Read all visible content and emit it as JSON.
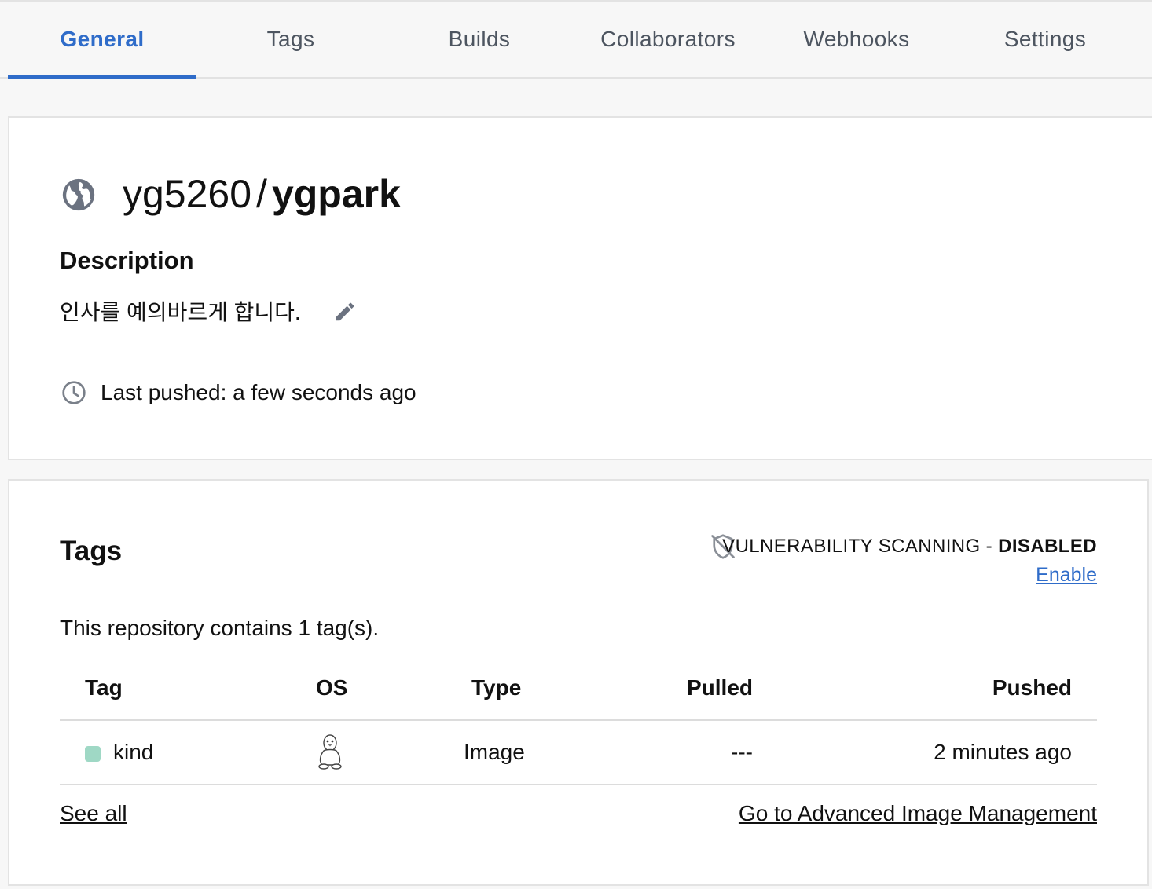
{
  "tabs": [
    {
      "label": "General",
      "active": true
    },
    {
      "label": "Tags",
      "active": false
    },
    {
      "label": "Builds",
      "active": false
    },
    {
      "label": "Collaborators",
      "active": false
    },
    {
      "label": "Webhooks",
      "active": false
    },
    {
      "label": "Settings",
      "active": false
    }
  ],
  "repo": {
    "visibility_icon": "globe-icon",
    "namespace": "yg5260",
    "separator": "/",
    "name": "ygpark",
    "description_heading": "Description",
    "description": "인사를 예의바르게 합니다.",
    "edit_icon": "pencil-icon",
    "last_pushed": "Last pushed: a few seconds ago",
    "clock_icon": "clock-icon"
  },
  "tags_section": {
    "heading": "Tags",
    "scan_icon": "shield-off-icon",
    "scan_label": "VULNERABILITY SCANNING - ",
    "scan_status": "DISABLED",
    "enable_link": "Enable",
    "count_text": "This repository contains 1 tag(s).",
    "columns": {
      "tag": "Tag",
      "os": "OS",
      "type": "Type",
      "pulled": "Pulled",
      "pushed": "Pushed"
    },
    "rows": [
      {
        "tag": "kind",
        "status_color": "#9fd8c5",
        "os_icon": "linux-tux-icon",
        "type": "Image",
        "pulled": "---",
        "pushed": "2 minutes ago"
      }
    ],
    "see_all": "See all",
    "advanced_link": "Go to Advanced Image Management"
  },
  "colors": {
    "accent": "#2f6cc9",
    "tab_text": "#4d5560",
    "background": "#f7f7f7"
  }
}
